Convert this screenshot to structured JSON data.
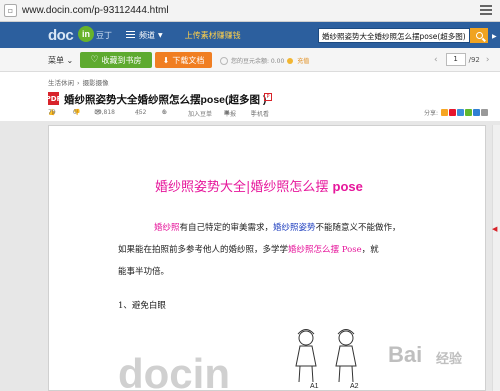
{
  "browser": {
    "url": "www.docin.com/p-93112444.html"
  },
  "header": {
    "logo_main": "doc",
    "logo_in": "in",
    "logo_cn": "豆丁",
    "channel_label": "频道",
    "upload_label": "上传素材赚赚钱",
    "search_value": "婚纱照姿势大全婚纱照怎么摆pose(超多图)"
  },
  "toolbar": {
    "menu_label": "菜单",
    "favorite_label": "收藏到书房",
    "download_label": "下载文档",
    "balance_text": "您的豆元余额: 0.00",
    "topup_label": "充值",
    "page_current": "1",
    "page_total": "/92"
  },
  "breadcrumb": [
    "生活休闲",
    "摄影摄像"
  ],
  "doc": {
    "pdf_badge": "PDF",
    "title": "婚纱照姿势大全婚纱照怎么摆pose(超多图 )",
    "vip_badge": "P",
    "meta": {
      "likes": "79",
      "dislikes": "0",
      "views": "19,818",
      "comments": "452",
      "shares": "6",
      "add_list": "加入豆单",
      "report": "举报",
      "mobile": "手机看",
      "share_label": "分享:"
    },
    "heading_cn": "婚纱照姿势大全|婚纱照怎么摆",
    "heading_en": "pose",
    "para1": {
      "a": "婚纱照",
      "b": "有自己特定的审美需求，",
      "c": "婚纱照姿势",
      "d": "不能随意义不能做作，"
    },
    "para2": {
      "a": "如果能在拍照前多参考他人的婚纱照，多学学",
      "b": "婚纱照怎么摆 Pose",
      "c": "，就"
    },
    "para3": "能事半功倍。",
    "section1": "1、避免白眼",
    "figure_labels": [
      "A1",
      "A2"
    ]
  },
  "watermark": {
    "docin": "docin",
    "baidu": "Bai",
    "jingyan": "经验"
  },
  "colors": {
    "header_blue": "#2c5f9e",
    "favorite_green": "#5eaa2f",
    "download_orange": "#f07e22",
    "heading_pink": "#e6169b",
    "link_blue": "#1f3fbf"
  }
}
